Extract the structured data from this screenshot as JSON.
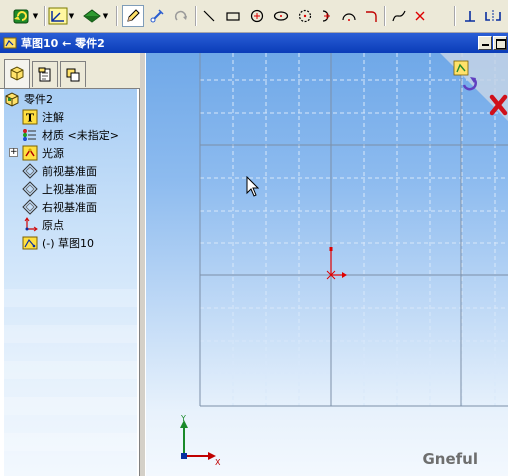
{
  "window": {
    "title": "草图10 ← 零件2"
  },
  "toolbar": {
    "tools": [
      {
        "name": "rebuild-dropdown",
        "icon": "rebuild-icon"
      },
      {
        "name": "sketch-relations-dropdown",
        "icon": "relations-icon"
      },
      {
        "name": "display-dropdown",
        "icon": "display-icon"
      },
      {
        "name": "sketch-tool",
        "icon": "pencil-icon"
      },
      {
        "name": "smart-dimension",
        "icon": "dimension-icon"
      },
      {
        "name": "rotate-tool",
        "icon": "rotate-icon"
      },
      {
        "name": "line-tool",
        "icon": "line-icon"
      },
      {
        "name": "rectangle-tool",
        "icon": "rectangle-icon"
      },
      {
        "name": "circle-tool",
        "icon": "circle-icon"
      },
      {
        "name": "ellipse-tool",
        "icon": "ellipse-icon"
      },
      {
        "name": "polygon-tool",
        "icon": "polygon-icon"
      },
      {
        "name": "tangent-arc-tool",
        "icon": "tangent-arc-icon"
      },
      {
        "name": "arc-tool",
        "icon": "arc-icon"
      },
      {
        "name": "fillet-tool",
        "icon": "fillet-icon"
      },
      {
        "name": "spline-tool",
        "icon": "spline-icon"
      },
      {
        "name": "point-tool",
        "icon": "point-icon"
      },
      {
        "name": "add-relation-tool",
        "icon": "perpendicular-icon"
      },
      {
        "name": "mirror-tool",
        "icon": "mirror-icon"
      }
    ]
  },
  "feature_tree": {
    "root": {
      "label": "零件2",
      "icon": "part-icon"
    },
    "items": [
      {
        "label": "注解",
        "icon": "annotation-icon",
        "expandable": false
      },
      {
        "label": "材质 <未指定>",
        "icon": "material-icon",
        "expandable": false
      },
      {
        "label": "光源",
        "icon": "lighting-icon",
        "expandable": true
      },
      {
        "label": "前视基准面",
        "icon": "plane-icon",
        "expandable": false
      },
      {
        "label": "上视基准面",
        "icon": "plane-icon",
        "expandable": false
      },
      {
        "label": "右视基准面",
        "icon": "plane-icon",
        "expandable": false
      },
      {
        "label": "原点",
        "icon": "origin-icon",
        "expandable": false
      },
      {
        "label": "(-) 草图10",
        "icon": "sketch-icon",
        "expandable": false
      }
    ]
  },
  "viewport": {
    "watermark": "Gneful",
    "triad": {
      "x_label": "X",
      "y_label": "Y"
    }
  },
  "colors": {
    "accent": "#0a3cb8",
    "origin": "#e00000",
    "confirm": "#3c9a2c",
    "cancel": "#d0101a"
  }
}
